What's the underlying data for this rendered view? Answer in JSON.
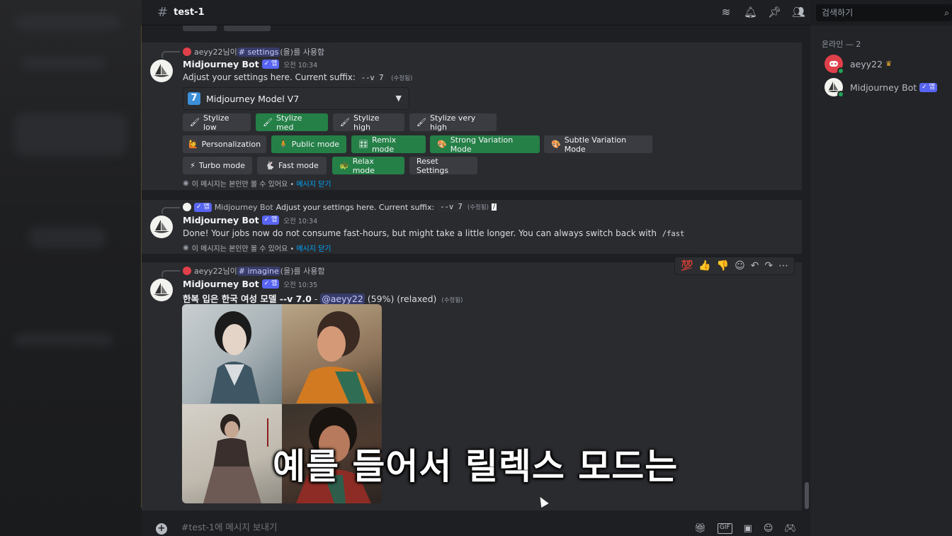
{
  "channel": {
    "name": "test-1"
  },
  "search": {
    "placeholder": "검색하기"
  },
  "members": {
    "section": "온라인 — 2",
    "list": [
      {
        "name": "aeyy22"
      },
      {
        "name": "Midjourney Bot",
        "badge": "✓ 앱"
      }
    ]
  },
  "colors": {
    "accent_green": "#248046",
    "blurple": "#5865f2",
    "link": "#00a8fc"
  },
  "msg1": {
    "ref_user": "aeyy22",
    "ref_prefix": " 님이 ",
    "ref_command": "# settings",
    "ref_suffix": "(을)를 사용함",
    "author": "Midjourney Bot",
    "badge": "✓ 앱",
    "time": "오전 10:34",
    "text": "Adjust your settings here. Current suffix:",
    "suffix_code": "--v 7",
    "edited": "(수정됨)",
    "select_num": "7",
    "select_label": "Midjourney Model V7",
    "rows": [
      [
        {
          "label": "Stylize low",
          "icon": "🖌",
          "green": false
        },
        {
          "label": "Stylize med",
          "icon": "🖌",
          "green": true
        },
        {
          "label": "Stylize high",
          "icon": "🖌",
          "green": false
        },
        {
          "label": "Stylize very high",
          "icon": "🖌",
          "green": false
        }
      ],
      [
        {
          "label": "Personalization",
          "icon": "🙋",
          "green": false
        },
        {
          "label": "Public mode",
          "icon": "🧍",
          "green": true
        },
        {
          "label": "Remix mode",
          "icon": "🎛",
          "green": true
        },
        {
          "label": "Strong Variation Mode",
          "icon": "🎨",
          "green": true
        },
        {
          "label": "Subtle Variation Mode",
          "icon": "🎨",
          "green": false
        }
      ],
      [
        {
          "label": "Turbo mode",
          "icon": "⚡",
          "green": false
        },
        {
          "label": "Fast mode",
          "icon": "🐇",
          "green": false
        },
        {
          "label": "Relax mode",
          "icon": "🐢",
          "green": true
        },
        {
          "label": "Reset Settings",
          "icon": "",
          "green": false
        }
      ]
    ],
    "ephemeral": "이 메시지는 본인만 볼 수 있어요 •",
    "dismiss": "메시지 닫기"
  },
  "msg2": {
    "ref_badge": "✓ 앱",
    "ref_author": "Midjourney Bot",
    "ref_text": "Adjust your settings here. Current suffix:",
    "ref_code": "--v 7",
    "ref_edited": "(수정됨)",
    "author": "Midjourney Bot",
    "badge": "✓ 앱",
    "time": "오전 10:34",
    "text": "Done! Your jobs now do not consume fast-hours, but might take a little longer. You can always switch back with",
    "code": "/fast",
    "ephemeral": "이 메시지는 본인만 볼 수 있어요 •",
    "dismiss": "메시지 닫기"
  },
  "msg3": {
    "ref_user": "aeyy22",
    "ref_prefix": " 님이 ",
    "ref_command": "# imagine",
    "ref_suffix": "(을)를 사용함",
    "author": "Midjourney Bot",
    "badge": "✓ 앱",
    "time": "오전 10:35",
    "prompt": "한복 입은 한국 여성 모델 --v 7.0",
    "dash": " - ",
    "mention": "@aeyy22",
    "progress": "(59%) (relaxed)",
    "edited": "(수정됨)"
  },
  "reactions": [
    "💯",
    "👍",
    "👎"
  ],
  "composer": {
    "placeholder": "#test-1에 메시지 보내기"
  },
  "subtitle": "예를 들어서 릴렉스 모드는"
}
